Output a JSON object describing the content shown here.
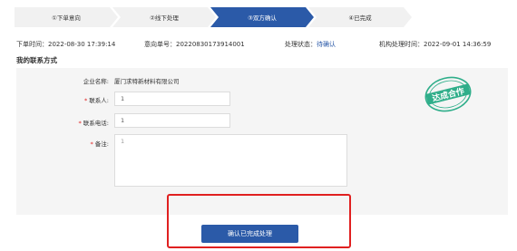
{
  "steps": [
    {
      "label": "①下单意向"
    },
    {
      "label": "②线下处理"
    },
    {
      "label": "③双方确认"
    },
    {
      "label": "④已完成"
    }
  ],
  "info": {
    "order_time_label": "下单时间：",
    "order_time": "2022-08-30 17:39:14",
    "intent_no_label": "意向单号：",
    "intent_no": "20220830173914001",
    "status_label": "处理状态：",
    "status": "待确认",
    "org_time_label": "机构处理时间：",
    "org_time": "2022-09-01 14:36:59"
  },
  "section_title": "我的联系方式",
  "form": {
    "company_label": "企业名称:",
    "company_value": "厦门求特新材料有限公司",
    "contact_label": "联系人:",
    "contact_value": "1",
    "phone_label": "联系电话:",
    "phone_value": "1",
    "remark_label": "备注:",
    "remark_value": "1"
  },
  "stamp": {
    "text": "达成合作",
    "color": "#2fae8a"
  },
  "confirm_button": "确认已完成处理",
  "colors": {
    "accent": "#2b5aa8",
    "highlight": "#e02020"
  }
}
